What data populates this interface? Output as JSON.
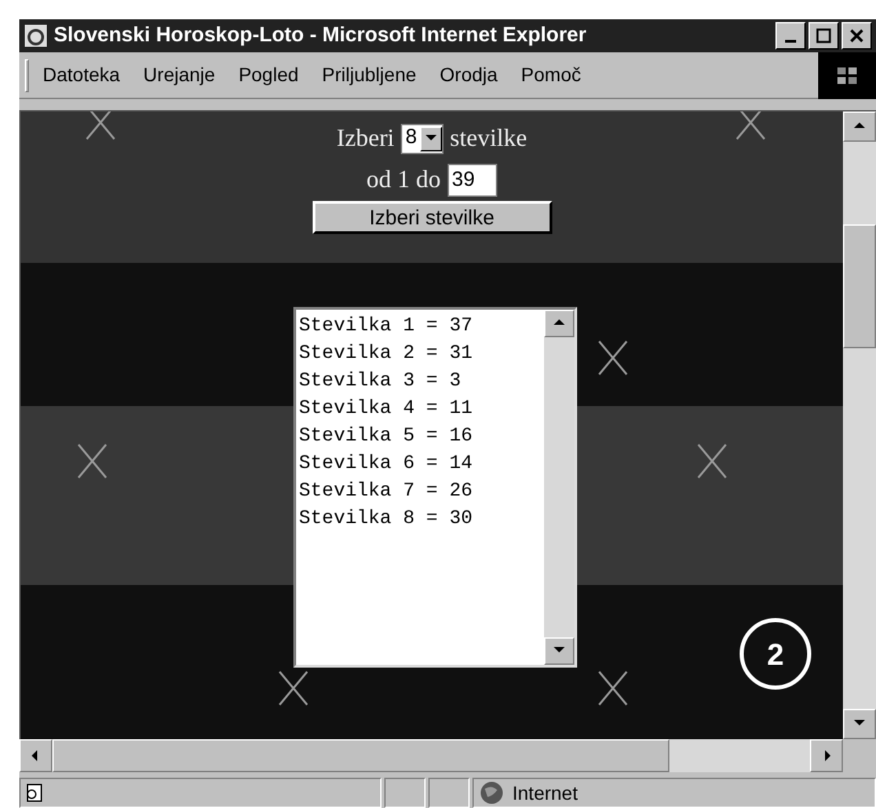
{
  "window": {
    "title": "Slovenski Horoskop-Loto - Microsoft Internet Explorer"
  },
  "menu": [
    {
      "label": "Datoteka"
    },
    {
      "label": "Urejanje"
    },
    {
      "label": "Pogled"
    },
    {
      "label": "Priljubljene"
    },
    {
      "label": "Orodja"
    },
    {
      "label": "Pomoč"
    }
  ],
  "form": {
    "line1_before": "Izberi",
    "count_select": {
      "value": "8"
    },
    "line1_after": "stevilke",
    "line2_label": "od 1 do",
    "max_field": {
      "value": "39"
    },
    "button": "Izberi stevilke"
  },
  "results": [
    "Stevilka 1 = 37",
    "Stevilka 2 = 31",
    "Stevilka 3 = 3",
    "Stevilka 4 = 11",
    "Stevilka 5 = 16",
    "Stevilka 6 = 14",
    "Stevilka 7 = 26",
    "Stevilka 8 = 30"
  ],
  "badge": "2",
  "status_bar": {
    "zone": "Internet"
  }
}
